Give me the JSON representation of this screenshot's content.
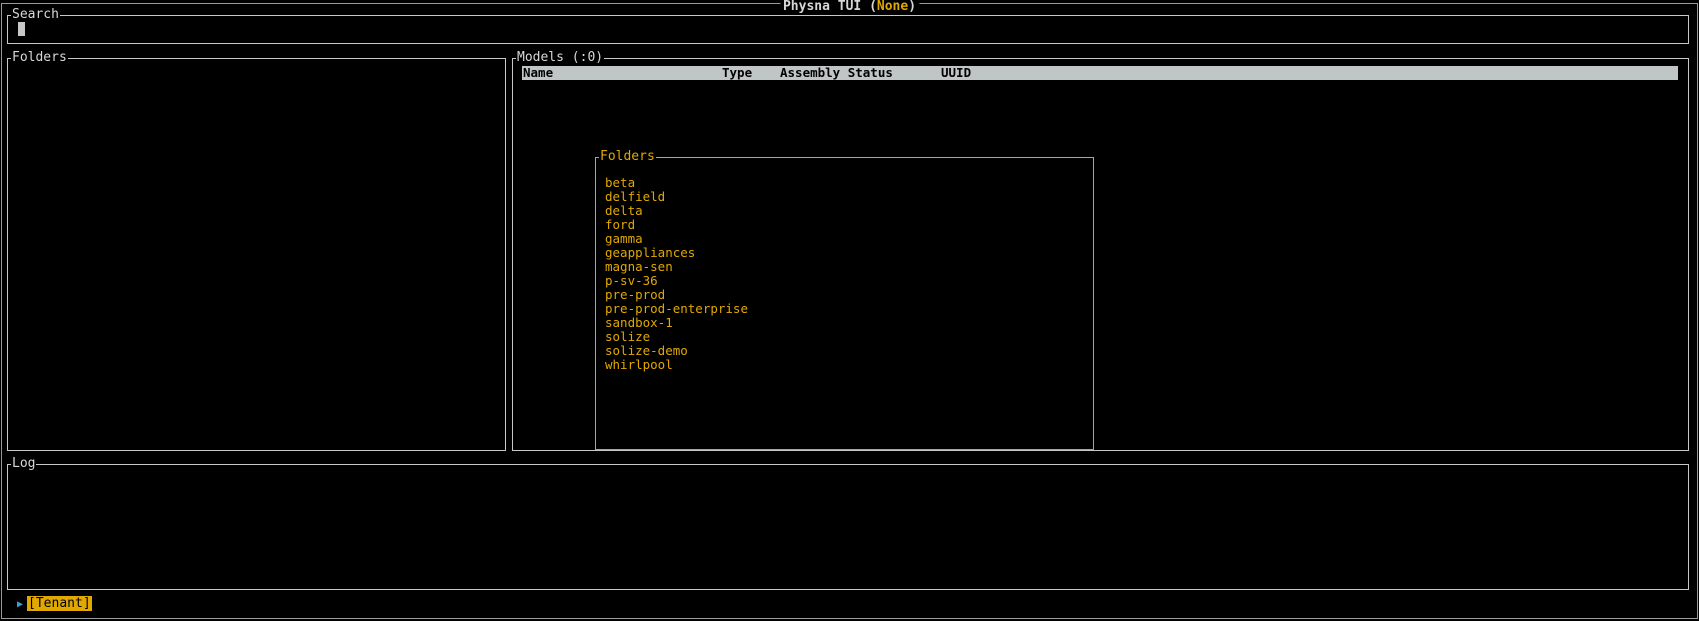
{
  "app": {
    "title": "Physna TUI",
    "env_open": "(",
    "env": "None",
    "env_close": ")"
  },
  "search": {
    "label": "Search",
    "value": ""
  },
  "folders_panel": {
    "label": "Folders"
  },
  "models_panel": {
    "label": "Models (:0)",
    "columns": [
      "Name",
      "Type",
      "Assembly Status",
      "UUID"
    ]
  },
  "folders_popup": {
    "label": "Folders",
    "items": [
      "beta",
      "delfield",
      "delta",
      "ford",
      "gamma",
      "geappliances",
      "magna-sen",
      "p-sv-36",
      "pre-prod",
      "pre-prod-enterprise",
      "sandbox-1",
      "solize",
      "solize-demo",
      "whirlpool"
    ]
  },
  "log_panel": {
    "label": "Log"
  },
  "status_bar": {
    "arrow": "▶",
    "tenant_label": "[Tenant]"
  },
  "colors": {
    "accent": "#e0a800",
    "border": "#c8c8c8",
    "table_header_bg": "#c0c6c6",
    "arrow": "#3aa0d8"
  }
}
